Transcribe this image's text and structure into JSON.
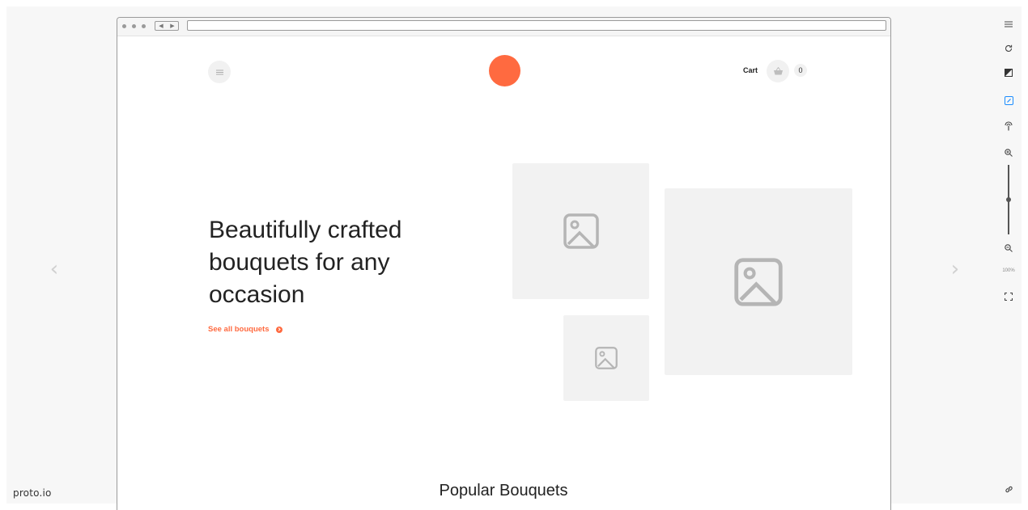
{
  "viewer": {
    "brand": "proto.io",
    "prev_arrow": "‹",
    "next_arrow": "›",
    "toolbar": {
      "zoom_level": "100%",
      "zoom_fraction": 0.5,
      "icons": [
        "menu-icon",
        "refresh-icon",
        "contrast-icon",
        "edit-icon",
        "broadcast-icon",
        "zoom-in-icon",
        "zoom-out-icon",
        "fullscreen-icon",
        "link-icon"
      ]
    }
  },
  "browser": {
    "back": "◀",
    "forward": "▶"
  },
  "site": {
    "header": {
      "cart_label": "Cart",
      "cart_count": "0"
    },
    "hero": {
      "title": "Beautifully crafted bouquets for any occasion",
      "link_label": "See all bouquets"
    },
    "sections": {
      "popular_title": "Popular Bouquets"
    }
  },
  "colors": {
    "accent": "#ff6a40",
    "placeholder": "#f2f2f2",
    "placeholder_icon": "#b5b5b5",
    "active_tool": "#1a8cff"
  }
}
